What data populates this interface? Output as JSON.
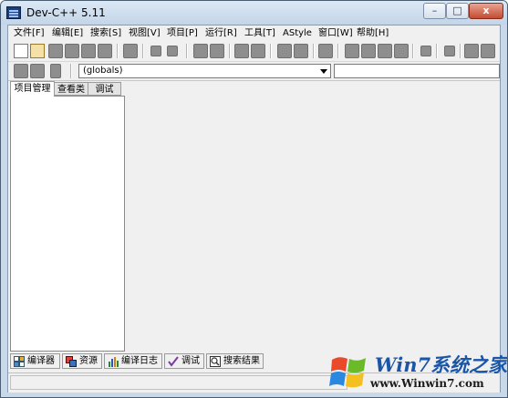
{
  "window": {
    "title": "Dev-C++ 5.11",
    "minimize_label": "–",
    "maximize_label": "□",
    "close_label": "x"
  },
  "menu": [
    "文件[F]",
    "编辑[E]",
    "搜索[S]",
    "视图[V]",
    "项目[P]",
    "运行[R]",
    "工具[T]",
    "AStyle",
    "窗口[W]",
    "帮助[H]"
  ],
  "scope_combo": {
    "value": "(globals)"
  },
  "left_tabs": [
    "项目管理",
    "查看类",
    "调试"
  ],
  "bottom_tabs": [
    "编译器",
    "资源",
    "编译日志",
    "调试",
    "搜索结果"
  ],
  "watermark": {
    "logo_text": "Win7系统之家",
    "url": "www.Winwin7.com"
  }
}
